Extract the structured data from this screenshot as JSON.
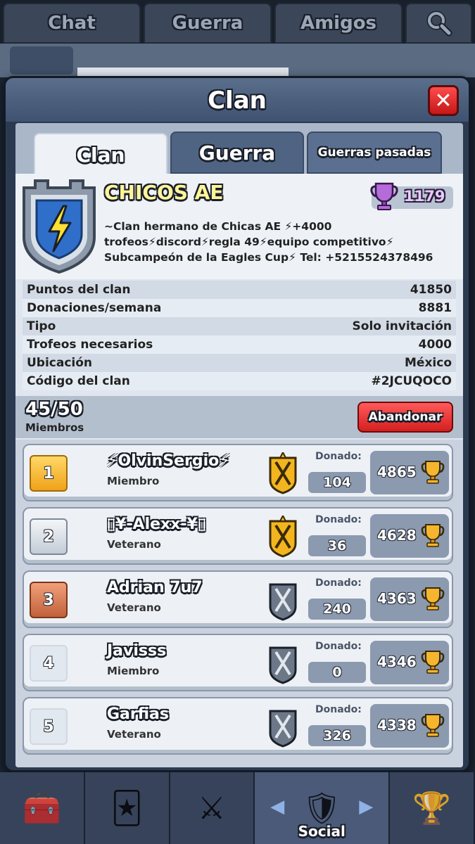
{
  "top_tabs": [
    "Chat",
    "Guerra",
    "Amigos"
  ],
  "modal": {
    "title": "Clan",
    "close_label": "✕",
    "tabs": [
      "Clan",
      "Guerra",
      "Guerras pasadas"
    ]
  },
  "clan": {
    "name": "CHICOS AE",
    "trophies": "1179",
    "description": "~Clan hermano de Chicas AE ⚡+4000 trofeos⚡discord⚡regla 49⚡equipo competitivo⚡ Subcampeón de la Eagles Cup⚡                  Tel: +5215524378496",
    "stats": [
      {
        "label": "Puntos del clan",
        "value": "41850"
      },
      {
        "label": "Donaciones/semana",
        "value": "8881"
      },
      {
        "label": "Tipo",
        "value": "Solo invitación"
      },
      {
        "label": "Trofeos necesarios",
        "value": "4000"
      },
      {
        "label": "Ubicación",
        "value": "México"
      },
      {
        "label": "Código del clan",
        "value": "#2JCUQOCO"
      }
    ]
  },
  "members_header": {
    "count": "45/50",
    "label": "Miembros",
    "leave_button": "Abandonar"
  },
  "members": [
    {
      "rank": "1",
      "name": "⚡OlvinSergio⚡",
      "role": "Miembro",
      "donated_label": "Donado:",
      "donated": "104",
      "trophies": "4865"
    },
    {
      "rank": "2",
      "name": "▯¥-Alexx-¥▯",
      "role": "Veterano",
      "donated_label": "Donado:",
      "donated": "36",
      "trophies": "4628"
    },
    {
      "rank": "3",
      "name": "Adrian 7u7",
      "role": "Veterano",
      "donated_label": "Donado:",
      "donated": "240",
      "trophies": "4363"
    },
    {
      "rank": "4",
      "name": "Javisss",
      "role": "Miembro",
      "donated_label": "Donado:",
      "donated": "0",
      "trophies": "4346"
    },
    {
      "rank": "5",
      "name": "Garfias",
      "role": "Veterano",
      "donated_label": "Donado:",
      "donated": "326",
      "trophies": "4338"
    }
  ],
  "bottom_nav": {
    "active_label": "Social",
    "icons": [
      "chest-icon",
      "cards-icon",
      "swords-icon",
      "clan-shield-icon",
      "tournament-icon"
    ]
  },
  "colors": {
    "clan_name": "#fff59a",
    "clan_trophy": "#b56bd9",
    "leave_button": "#e33a3a",
    "gold_rank": "#f5b52e"
  }
}
